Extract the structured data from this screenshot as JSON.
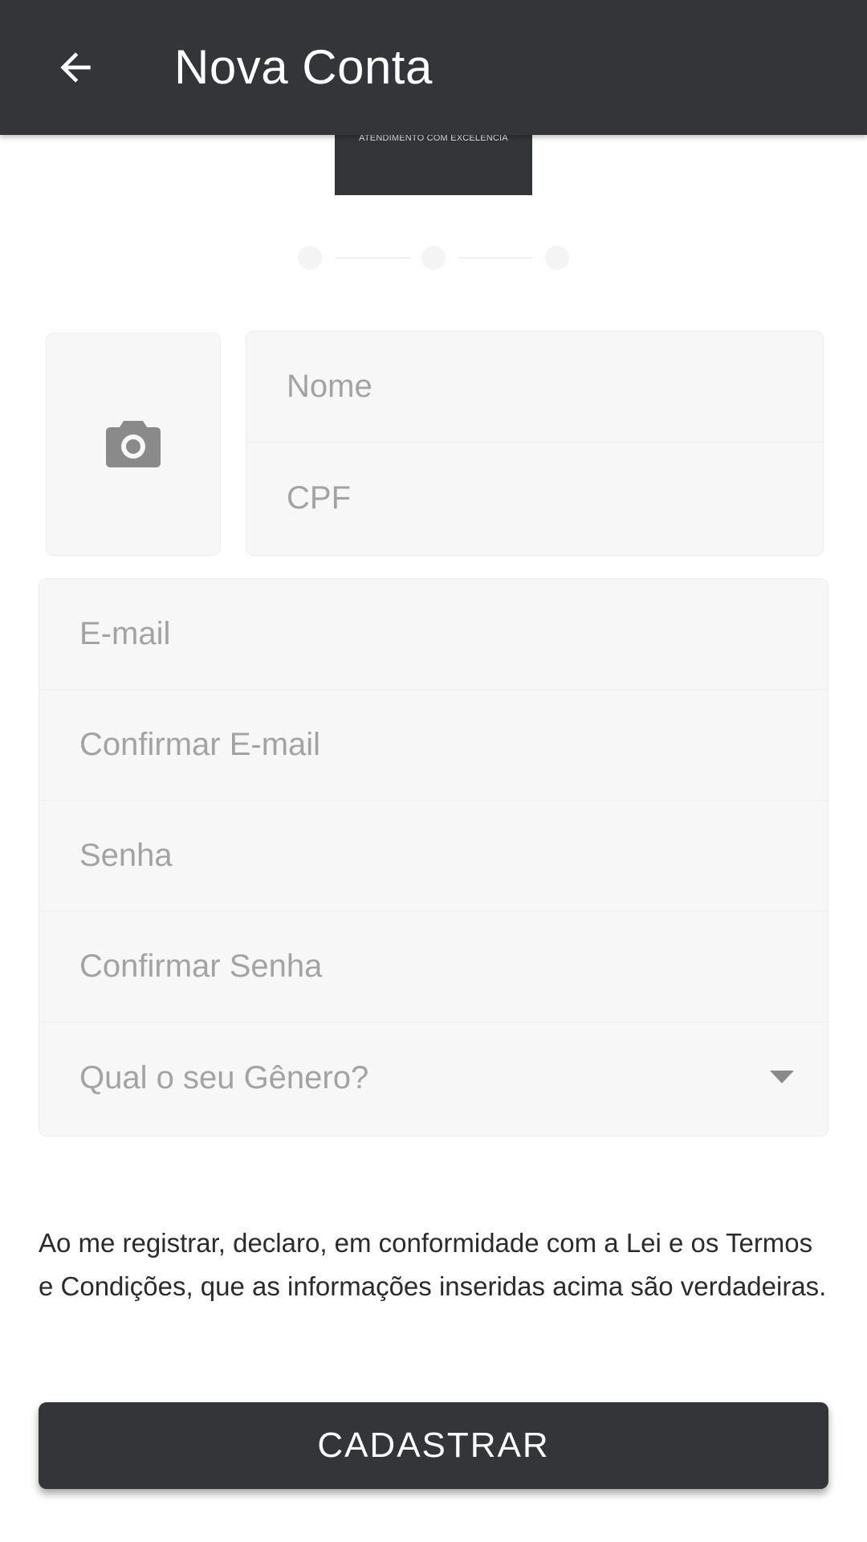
{
  "appbar": {
    "title": "Nova Conta",
    "back_icon": "arrow-back-icon",
    "background": "#343538"
  },
  "logo": {
    "tagline": "ATENDIMENTO COM EXCELÊNCIA"
  },
  "stepper": {
    "steps": 3,
    "current_step": 1
  },
  "photo": {
    "icon": "camera-icon"
  },
  "fields": {
    "nome_placeholder": "Nome",
    "cpf_placeholder": "CPF",
    "email_placeholder": "E-mail",
    "confirm_email_placeholder": "Confirmar E-mail",
    "senha_placeholder": "Senha",
    "confirm_senha_placeholder": "Confirmar Senha",
    "genero_placeholder": "Qual o seu Gênero?"
  },
  "declaration": "Ao me registrar, declaro, em conformidade com a Lei e os Termos e Condições, que as informações inseridas acima são verdadeiras.",
  "submit_label": "CADASTRAR",
  "colors": {
    "primary": "#343538",
    "field_bg": "#f7f7f7",
    "placeholder": "#a3a3a3"
  }
}
